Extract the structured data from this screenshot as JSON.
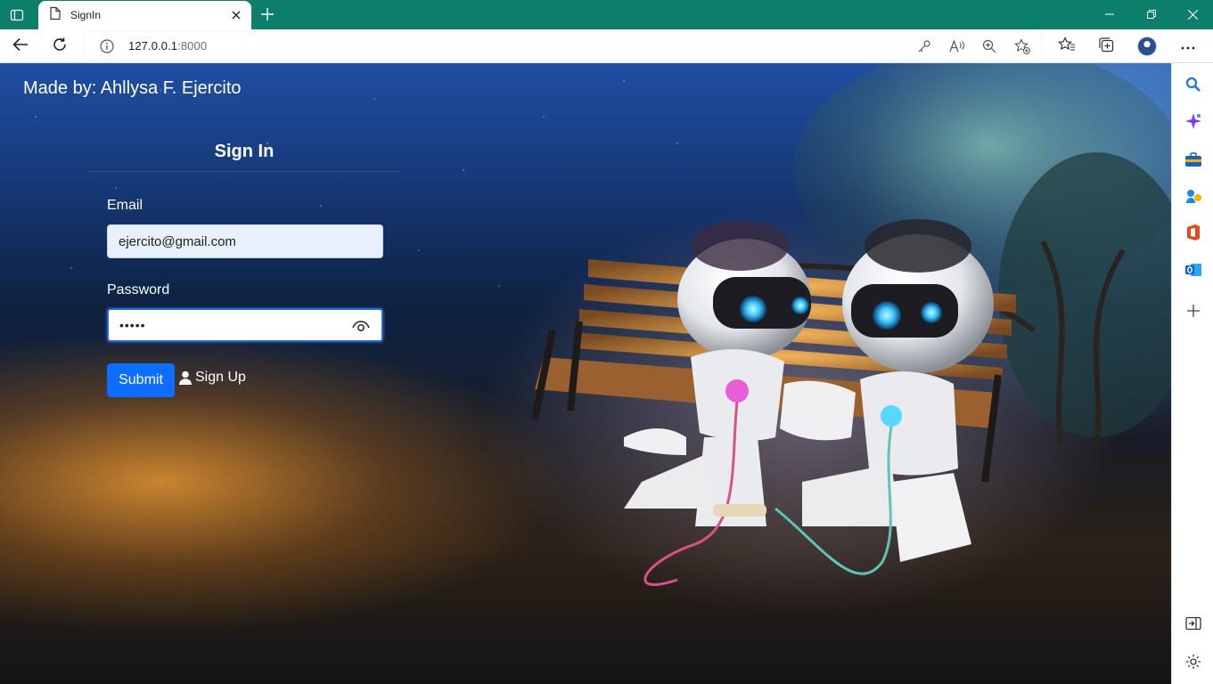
{
  "browser": {
    "tab_title": "SignIn",
    "url_host": "127.0.0.1",
    "url_port": ":8000",
    "theme_color": "#0b7f6a"
  },
  "page": {
    "made_by": "Made by: Ahllysa F. Ejercito",
    "form": {
      "title": "Sign In",
      "email_label": "Email",
      "email_value": "ejercito@gmail.com",
      "password_label": "Password",
      "password_masked": "•••••",
      "submit_label": "Submit",
      "signup_label": "Sign Up"
    },
    "accent_color": "#0d6efd"
  },
  "icons": {
    "toolbar": [
      "back-arrow-icon",
      "refresh-icon",
      "info-icon",
      "key-icon",
      "read-aloud-icon",
      "zoom-icon",
      "add-favorite-icon",
      "favorites-icon",
      "collections-icon",
      "profile-avatar",
      "more-icon"
    ],
    "sidebar": [
      "search-icon",
      "copilot-icon",
      "tools-icon",
      "games-icon",
      "office-icon",
      "outlook-icon",
      "add-icon",
      "hide-sidebar-icon",
      "settings-icon"
    ]
  }
}
